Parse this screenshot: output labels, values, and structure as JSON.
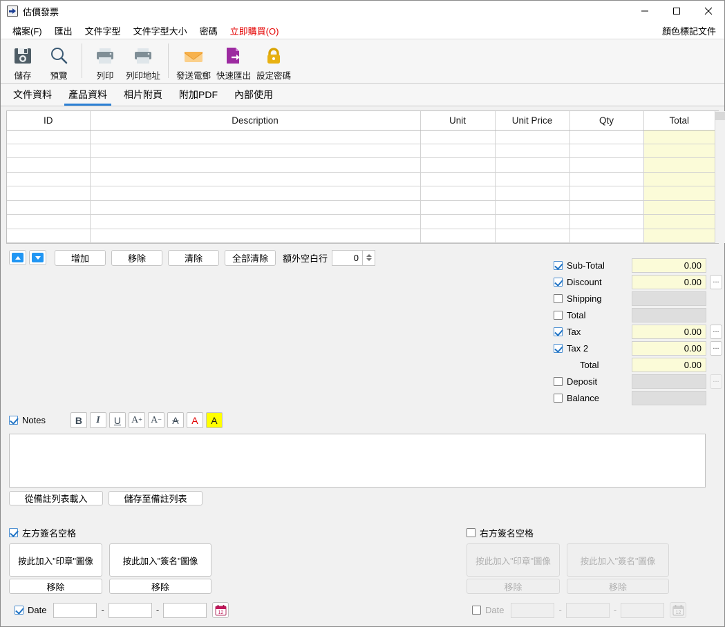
{
  "window": {
    "title": "估價發票",
    "icon": "export-document-icon",
    "minimize": "−",
    "maximize": "□",
    "close": "✕"
  },
  "menubar": {
    "items": [
      {
        "label": "檔案(F)",
        "name": "menu-file"
      },
      {
        "label": "匯出",
        "name": "menu-export"
      },
      {
        "label": "文件字型",
        "name": "menu-document-font"
      },
      {
        "label": "文件字型大小",
        "name": "menu-document-font-size"
      },
      {
        "label": "密碼",
        "name": "menu-password"
      },
      {
        "label": "立即購買(O)",
        "name": "menu-buy-now",
        "accent": "#e40000"
      }
    ],
    "right_label": "顏色標記文件"
  },
  "toolbar": {
    "items": [
      {
        "label": "儲存",
        "icon": "save-icon"
      },
      {
        "label": "預覽",
        "icon": "preview-magnifier-icon"
      },
      {
        "label": "列印",
        "icon": "print-icon"
      },
      {
        "label": "列印地址",
        "icon": "print-address-icon"
      },
      {
        "label": "發送電郵",
        "icon": "email-icon"
      },
      {
        "label": "快速匯出",
        "icon": "quick-export-icon"
      },
      {
        "label": "設定密碼",
        "icon": "lock-icon"
      }
    ]
  },
  "tabs": [
    {
      "label": "文件資料",
      "active": false
    },
    {
      "label": "產品資料",
      "active": true
    },
    {
      "label": "相片附頁",
      "active": false
    },
    {
      "label": "附加PDF",
      "active": false
    },
    {
      "label": "內部使用",
      "active": false
    }
  ],
  "grid": {
    "columns": [
      "ID",
      "Description",
      "Unit",
      "Unit Price",
      "Qty",
      "Total"
    ],
    "rows": [
      [
        "",
        "",
        "",
        "",
        "",
        ""
      ],
      [
        "",
        "",
        "",
        "",
        "",
        ""
      ],
      [
        "",
        "",
        "",
        "",
        "",
        ""
      ],
      [
        "",
        "",
        "",
        "",
        "",
        ""
      ],
      [
        "",
        "",
        "",
        "",
        "",
        ""
      ],
      [
        "",
        "",
        "",
        "",
        "",
        ""
      ],
      [
        "",
        "",
        "",
        "",
        "",
        ""
      ],
      [
        "",
        "",
        "",
        "",
        "",
        ""
      ]
    ],
    "total_column_color": "#fbfbd8"
  },
  "rowbar": {
    "move_up": "move-up-icon",
    "move_down": "move-down-icon",
    "add": "增加",
    "remove": "移除",
    "clear": "清除",
    "clear_all": "全部清除",
    "extra_blank_rows_label": "額外空白行",
    "extra_blank_rows_value": "0"
  },
  "totals": {
    "rows": [
      {
        "label": "Sub-Total",
        "checked": true,
        "enabled": true,
        "value": "0.00",
        "has_dots": false
      },
      {
        "label": "Discount",
        "checked": true,
        "enabled": true,
        "value": "0.00",
        "has_dots": true
      },
      {
        "label": "Shipping",
        "checked": false,
        "enabled": false,
        "value": "",
        "has_dots": false
      },
      {
        "label": "Total",
        "checked": false,
        "enabled": false,
        "value": "",
        "has_dots": false
      },
      {
        "label": "Tax",
        "checked": true,
        "enabled": true,
        "value": "0.00",
        "has_dots": true
      },
      {
        "label": "Tax 2",
        "checked": true,
        "enabled": true,
        "value": "0.00",
        "has_dots": true
      },
      {
        "label": "Total",
        "checked": null,
        "enabled": true,
        "value": "0.00",
        "has_dots": false,
        "indent": true
      },
      {
        "label": "Deposit",
        "checked": false,
        "enabled": false,
        "value": "",
        "has_dots": true,
        "dots_disabled": true
      },
      {
        "label": "Balance",
        "checked": false,
        "enabled": false,
        "value": "",
        "has_dots": false
      }
    ],
    "dots_label": "..."
  },
  "notes": {
    "checkbox_label": "Notes",
    "checked": true,
    "format_buttons": [
      {
        "label": "B",
        "name": "bold-button"
      },
      {
        "label": "I",
        "name": "italic-button"
      },
      {
        "label": "U",
        "name": "underline-button"
      },
      {
        "label": "A",
        "sup": "+",
        "name": "increase-font-size-button"
      },
      {
        "label": "A",
        "sup": "−",
        "name": "decrease-font-size-button"
      },
      {
        "label": "A",
        "name": "strikethrough-button"
      },
      {
        "label": "A",
        "name": "font-color-button"
      },
      {
        "label": "A",
        "name": "highlight-color-button"
      }
    ],
    "text": "",
    "load_button": "從備註列表載入",
    "save_button": "儲存至備註列表"
  },
  "signatures": {
    "left": {
      "checkbox_label": "左方簽名空格",
      "checked": true,
      "enabled": true,
      "stamp_button": "按此加入\"印章\"圖像",
      "sign_button": "按此加入\"簽名\"圖像",
      "remove_button": "移除"
    },
    "right": {
      "checkbox_label": "右方簽名空格",
      "checked": false,
      "enabled": false,
      "stamp_button": "按此加入\"印章\"圖像",
      "sign_button": "按此加入\"簽名\"圖像",
      "remove_button": "移除"
    }
  },
  "dates": {
    "left": {
      "label": "Date",
      "checked": true,
      "enabled": true,
      "part1": "",
      "part2": "",
      "part3": "",
      "separator": "-",
      "calendar_icon": "calendar-icon",
      "calendar_day": "12"
    },
    "right": {
      "label": "Date",
      "checked": false,
      "enabled": false,
      "part1": "",
      "part2": "",
      "part3": "",
      "separator": "-",
      "calendar_icon": "calendar-icon",
      "calendar_day": "12"
    }
  },
  "colors": {
    "accent_blue": "#2a7fd4",
    "buy_red": "#e40000",
    "yellow_field": "#fbfbd8",
    "disabled_field": "#dedede"
  }
}
